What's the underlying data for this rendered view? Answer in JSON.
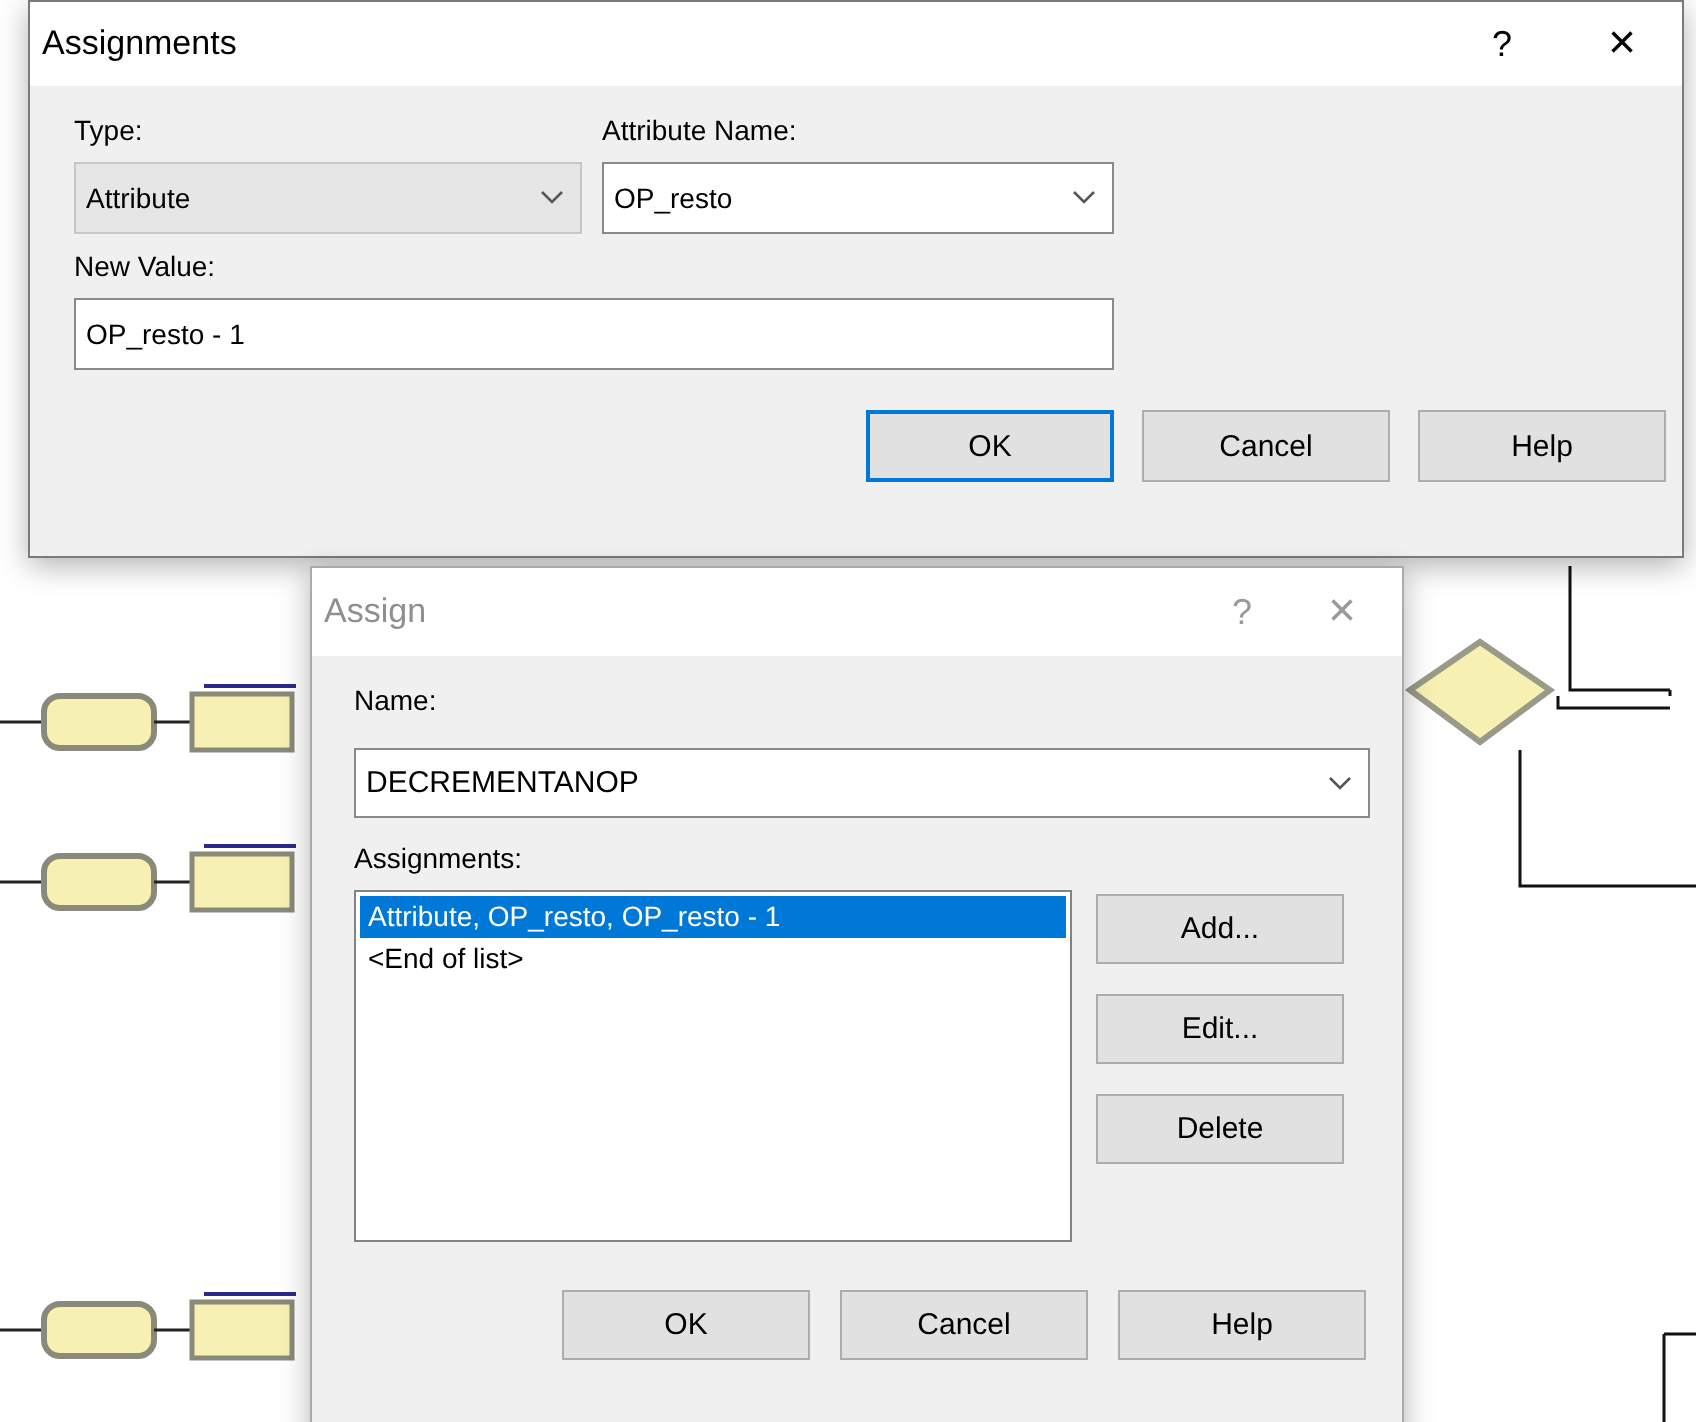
{
  "assignments_dialog": {
    "title": "Assignments",
    "active": true,
    "help_glyph": "?",
    "close_glyph": "×",
    "type": {
      "label": "Type:",
      "value": "Attribute",
      "disabled": true
    },
    "attribute_name": {
      "label": "Attribute Name:",
      "value": "OP_resto",
      "disabled": false
    },
    "new_value": {
      "label": "New Value:",
      "value": "OP_resto - 1"
    },
    "buttons": [
      {
        "label": "OK",
        "default": true
      },
      {
        "label": "Cancel",
        "default": false
      },
      {
        "label": "Help",
        "default": false
      }
    ]
  },
  "assign_dialog": {
    "title": "Assign",
    "active": false,
    "help_glyph": "?",
    "close_glyph": "×",
    "name": {
      "label": "Name:",
      "value": "DECREMENTANOP"
    },
    "assignments_label": "Assignments:",
    "list": [
      {
        "text": "Attribute, OP_resto, OP_resto - 1",
        "selected": true
      },
      {
        "text": "<End of list>",
        "selected": false
      }
    ],
    "side_buttons": [
      "Add...",
      "Edit...",
      "Delete"
    ],
    "buttons": [
      {
        "label": "OK",
        "default": false
      },
      {
        "label": "Cancel",
        "default": false
      },
      {
        "label": "Help",
        "default": false
      }
    ]
  }
}
